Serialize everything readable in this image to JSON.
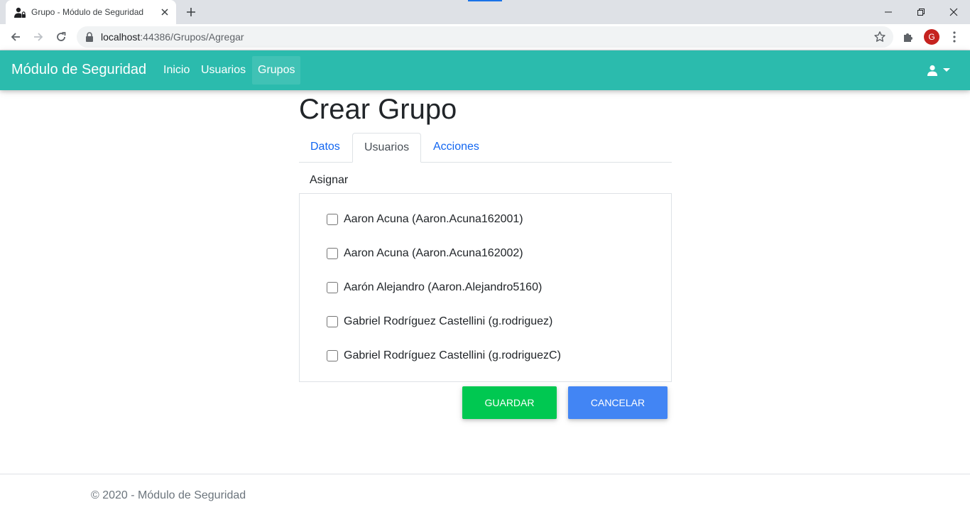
{
  "browser": {
    "tab_title": "Grupo - Módulo de Seguridad",
    "url_host": "localhost",
    "url_rest": ":44386/Grupos/Agregar",
    "profile_initial": "G",
    "accent": "#1a73e8"
  },
  "navbar": {
    "brand": "Módulo de Seguridad",
    "links": [
      {
        "label": "Inicio",
        "active": false
      },
      {
        "label": "Usuarios",
        "active": false
      },
      {
        "label": "Grupos",
        "active": true
      }
    ],
    "background": "#2bbbad",
    "user_icon": "user-icon"
  },
  "page": {
    "title": "Crear Grupo",
    "tabs": [
      {
        "label": "Datos",
        "active": false
      },
      {
        "label": "Usuarios",
        "active": true
      },
      {
        "label": "Acciones",
        "active": false
      }
    ],
    "assign_label": "Asignar",
    "users": [
      {
        "label": "Aaron Acuna (Aaron.Acuna162001)",
        "checked": false
      },
      {
        "label": "Aaron Acuna (Aaron.Acuna162002)",
        "checked": false
      },
      {
        "label": "Aarón Alejandro (Aaron.Alejandro5160)",
        "checked": false
      },
      {
        "label": "Gabriel Rodríguez Castellini (g.rodriguez)",
        "checked": false
      },
      {
        "label": "Gabriel Rodríguez Castellini (g.rodriguezC)",
        "checked": false
      }
    ],
    "buttons": {
      "save": "GUARDAR",
      "cancel": "CANCELAR",
      "save_color": "#00c851",
      "cancel_color": "#4285f4"
    }
  },
  "footer": {
    "text": "© 2020 - Módulo de Seguridad"
  }
}
